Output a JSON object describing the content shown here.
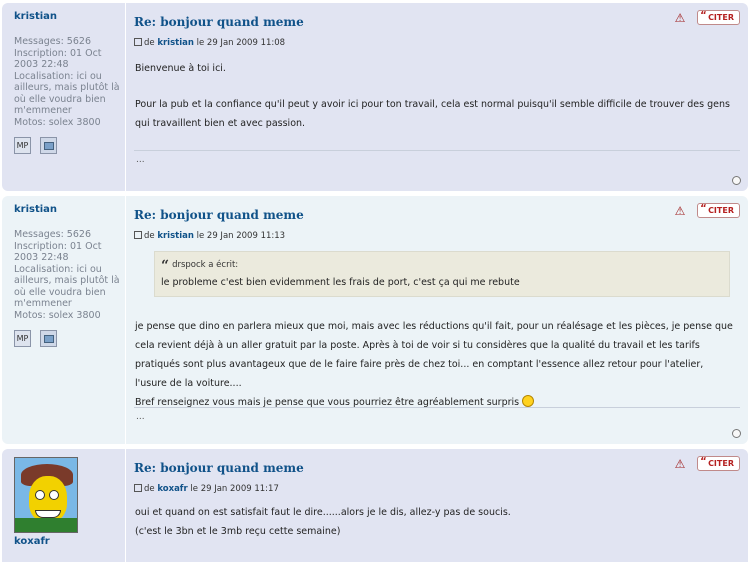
{
  "posts": [
    {
      "author": "kristian",
      "details": [
        "Messages: 5626",
        "Inscription: 01 Oct 2003 22:48",
        "Localisation: ici ou ailleurs, mais plutôt là où elle voudra bien m'emmener",
        "Motos: solex 3800"
      ],
      "pm_label": "MP",
      "title": "Re: bonjour quand meme",
      "by_prefix": "de",
      "by_author": "kristian",
      "date": "le 29 Jan 2009 11:08",
      "quote_button": "CITER",
      "paragraphs": [
        "Bienvenue à toi ici.",
        "Pour la pub et la confiance qu'il peut y avoir ici pour ton travail, cela est normal puisqu'il semble difficile de trouver des gens qui travaillent bien et avec passion."
      ],
      "signature": "..."
    },
    {
      "author": "kristian",
      "details": [
        "Messages: 5626",
        "Inscription: 01 Oct 2003 22:48",
        "Localisation: ici ou ailleurs, mais plutôt là où elle voudra bien m'emmener",
        "Motos: solex 3800"
      ],
      "pm_label": "MP",
      "title": "Re: bonjour quand meme",
      "by_prefix": "de",
      "by_author": "kristian",
      "date": "le 29 Jan 2009 11:13",
      "quote_button": "CITER",
      "quote": {
        "cite": "drspock a écrit:",
        "text": "le probleme c'est bien evidemment les frais de port, c'est ça qui me rebute"
      },
      "paragraphs": [
        "je pense que dino en parlera mieux que moi, mais avec les réductions qu'il fait, pour un réalésage et les pièces, je pense que cela revient déjà à un aller gratuit par la poste. Après à toi de voir si tu considères que la qualité du travail et les tarifs pratiqués sont plus avantageux que de le faire faire près de chez toi... en comptant l'essence allez retour pour l'atelier, l'usure de la voiture....",
        "Bref renseignez vous mais je pense que vous pourriez être agréablement surpris"
      ],
      "signature": "..."
    },
    {
      "author": "koxafr",
      "title": "Re: bonjour quand meme",
      "by_prefix": "de",
      "by_author": "koxafr",
      "date": "le 29 Jan 2009 11:17",
      "quote_button": "CITER",
      "paragraphs": [
        "oui et quand on est satisfait faut le dire......alors je le dis, allez-y pas de soucis.",
        "(c'est le 3bn et le 3mb reçu cette semaine)"
      ]
    }
  ],
  "icons": {
    "report": "report-icon",
    "quote": "quote-icon",
    "top": "back-to-top-icon",
    "post": "post-icon",
    "smiley": "wink-smiley-icon"
  }
}
